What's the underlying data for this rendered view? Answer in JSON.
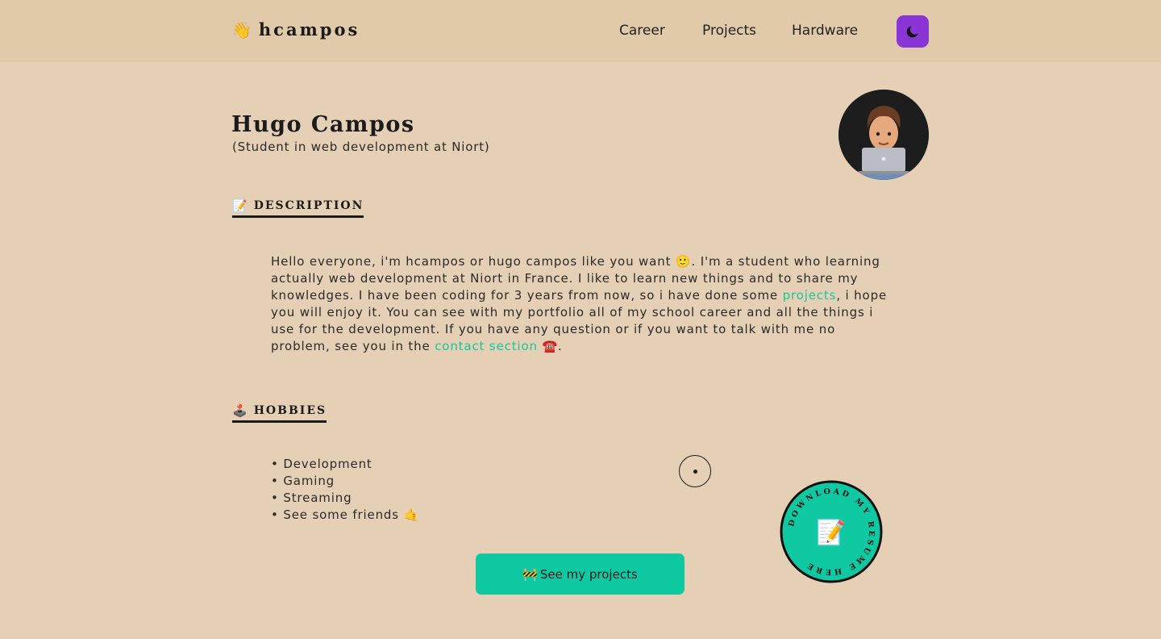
{
  "header": {
    "brand_emoji": "👋",
    "brand_name": "hcampos",
    "nav": {
      "career": "Career",
      "projects": "Projects",
      "hardware": "Hardware"
    },
    "theme_toggle_icon": "moon-icon"
  },
  "profile": {
    "name": "Hugo Campos",
    "subtitle": "(Student in web development at Niort)",
    "avatar_icon": "memoji-laptop-avatar"
  },
  "description": {
    "emoji": "📝",
    "heading": "DESCRIPTION",
    "text_1": "Hello everyone, i'm hcampos or hugo campos like you want 🙂. I'm a student who learning actually web development at Niort in France. I like to learn new things and to share my knowledges. I have been coding for 3 years from now, so i have done some ",
    "link_projects": "projects",
    "text_2": ", i hope you will enjoy it. You can see with my portfolio all of my school career and all the things i use for the development. If you have any question or if you want to talk with me no problem, see you in the ",
    "link_contact": "contact section",
    "text_3": " ☎️."
  },
  "hobbies": {
    "emoji": "🕹️",
    "heading": "HOBBIES",
    "items": [
      "Development",
      "Gaming",
      "Streaming",
      "See some friends 🤙"
    ]
  },
  "cta": {
    "emoji": "🚧",
    "label": "See my projects"
  },
  "resume_badge": {
    "text": "DOWNLOAD MY RESUME HERE",
    "emoji": "📝"
  },
  "colors": {
    "background": "#e5d0b5",
    "header_bg": "#e1caaa",
    "accent": "#16c79e",
    "theme_button": "#8a35d6",
    "text": "#1b1b1b"
  }
}
